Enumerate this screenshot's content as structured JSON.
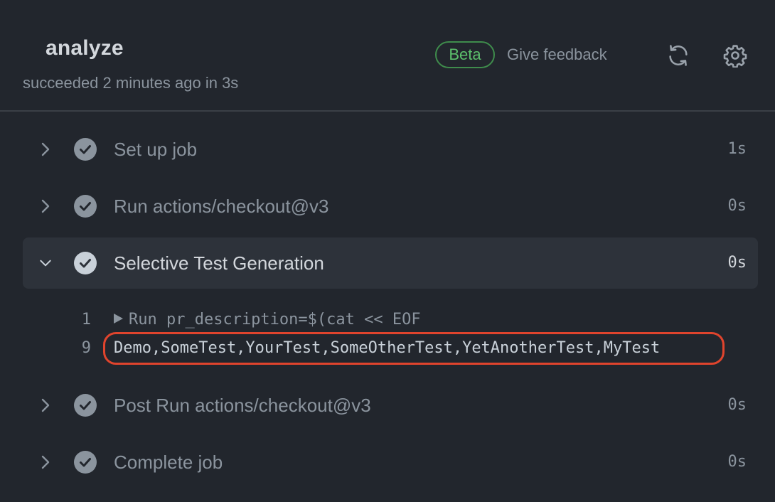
{
  "header": {
    "job_title": "analyze",
    "status": "succeeded 2 minutes ago in 3s",
    "beta_label": "Beta",
    "feedback_label": "Give feedback",
    "refresh_icon": "refresh-icon",
    "settings_icon": "gear-icon"
  },
  "steps": [
    {
      "name": "Set up job",
      "duration": "1s",
      "expanded": false
    },
    {
      "name": "Run actions/checkout@v3",
      "duration": "0s",
      "expanded": false
    },
    {
      "name": "Selective Test Generation",
      "duration": "0s",
      "expanded": true
    },
    {
      "name": "Post Run actions/checkout@v3",
      "duration": "0s",
      "expanded": false
    },
    {
      "name": "Complete job",
      "duration": "0s",
      "expanded": false
    }
  ],
  "log": [
    {
      "line": "1",
      "text": "Run pr_description=$(cat << EOF"
    },
    {
      "line": "9",
      "text": "Demo,SomeTest,YourTest,SomeOtherTest,YetAnotherTest,MyTest"
    }
  ],
  "colors": {
    "background": "#22262d",
    "expanded_row": "#2d323a",
    "success_badge": "#5cbf6c",
    "highlight": "#e0442d"
  }
}
